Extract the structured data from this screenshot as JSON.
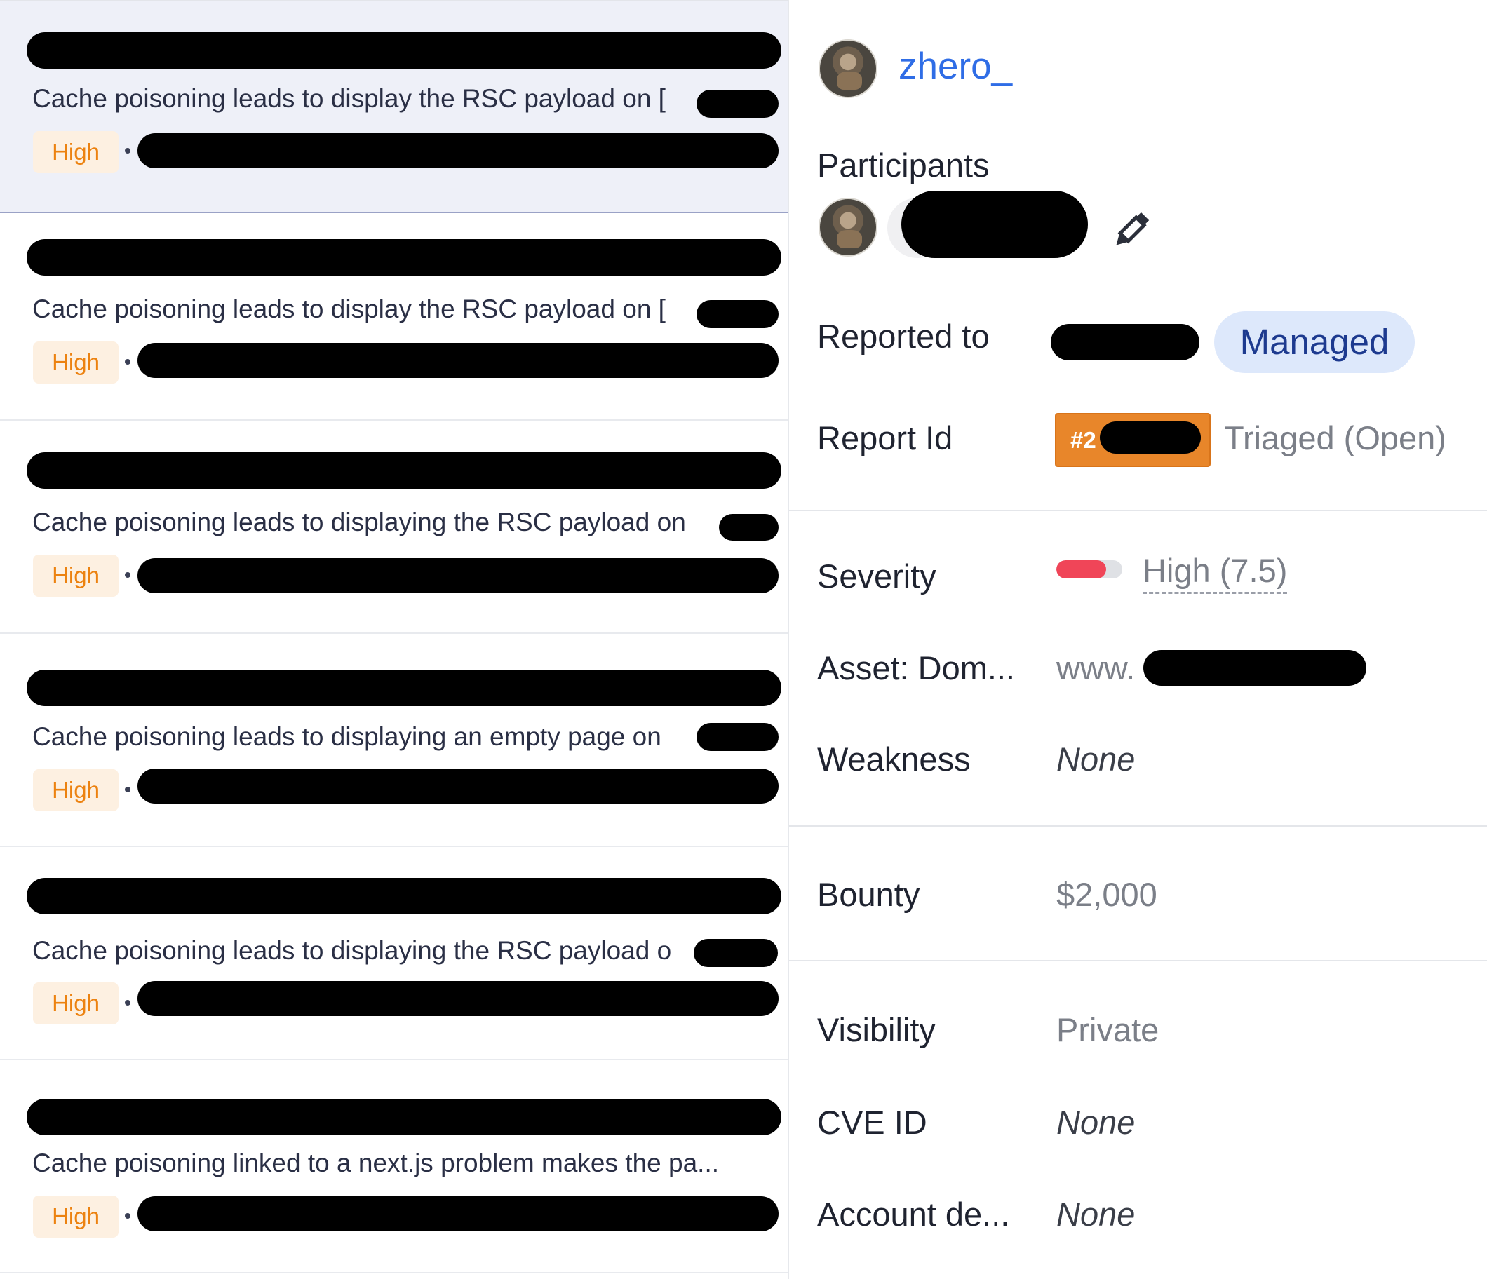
{
  "report_list": {
    "items": [
      {
        "title": "Cache poisoning leads to display the RSC payload on [",
        "severity": "High",
        "selected": true
      },
      {
        "title": "Cache poisoning leads to display the RSC payload on [",
        "severity": "High",
        "selected": false
      },
      {
        "title": "Cache poisoning leads to displaying the RSC payload on",
        "severity": "High",
        "selected": false
      },
      {
        "title": "Cache poisoning leads to displaying an empty page on",
        "severity": "High",
        "selected": false
      },
      {
        "title": "Cache poisoning leads to displaying the RSC payload o",
        "severity": "High",
        "selected": false
      },
      {
        "title": "Cache poisoning linked to a next.js problem makes the pa...",
        "severity": "High",
        "selected": false
      }
    ]
  },
  "details": {
    "reporter": {
      "name": "zhero_"
    },
    "participants_label": "Participants",
    "reported_to": {
      "label": "Reported to",
      "badge": "Managed"
    },
    "report_id": {
      "label": "Report Id",
      "badge_prefix": "#2",
      "status": "Triaged (Open)"
    },
    "severity": {
      "label": "Severity",
      "value": "High (7.5)",
      "score": 7.5,
      "bar_fill": 0.75,
      "bar_color": "#f04558"
    },
    "asset": {
      "label": "Asset: Dom...",
      "value": "www."
    },
    "weakness": {
      "label": "Weakness",
      "value": "None"
    },
    "bounty": {
      "label": "Bounty",
      "value": "$2,000"
    },
    "visibility": {
      "label": "Visibility",
      "value": "Private"
    },
    "cve_id": {
      "label": "CVE ID",
      "value": "None"
    },
    "account_details": {
      "label": "Account de...",
      "value": "None"
    }
  },
  "colors": {
    "severity_high_text": "#ec8210",
    "severity_high_bg": "#fdf0e1",
    "link_blue": "#2f6de6",
    "managed_bg": "#dde8fb",
    "report_id_badge": "#e8862a"
  },
  "icons": {
    "edit": "pencil-icon"
  }
}
